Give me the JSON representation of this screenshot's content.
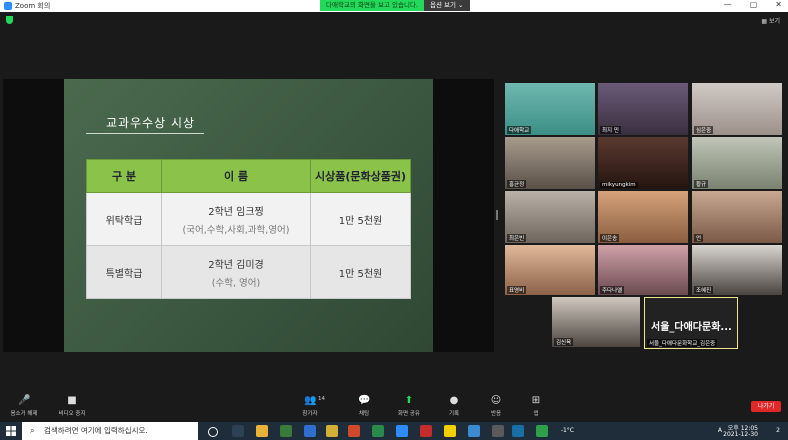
{
  "titlebar": {
    "app_title": "Zoom 회의",
    "min": "—",
    "max": "▢",
    "close": "✕"
  },
  "share_banner": {
    "message": "다애학교의 화면을 보고 있습니다.",
    "view_option": "옵션 보기 ⌄"
  },
  "view_button": "▦ 보기",
  "slide": {
    "title": "교과우수상 시상",
    "table": {
      "headers": [
        "구 분",
        "이 름",
        "시상품(문화상품권)"
      ],
      "rows": [
        {
          "category": "위탁학급",
          "name": "2학년 임크찡",
          "subjects": "(국어,수학,사회,과학,영어)",
          "prize": "1만 5천원"
        },
        {
          "category": "특별학급",
          "name": "2학년 김미경",
          "subjects": "(수학, 영어)",
          "prize": "1만 5천원"
        }
      ]
    }
  },
  "participants": [
    {
      "name": "다애학교"
    },
    {
      "name": "최지 민"
    },
    {
      "name": "심은중"
    },
    {
      "name": "홍균정"
    },
    {
      "name": "mikyungkim"
    },
    {
      "name": "황규"
    },
    {
      "name": "최은빈"
    },
    {
      "name": "이은송"
    },
    {
      "name": "언"
    },
    {
      "name": "표영비"
    },
    {
      "name": "주다나엘"
    },
    {
      "name": "조혜진"
    },
    {
      "name": "김신육"
    },
    {
      "name": "서울_다애다문화학교_김은중",
      "big_label": "서울_다애다문화..."
    }
  ],
  "toolbar": {
    "mute": "음소거 해제",
    "video": "비디오 중지",
    "participants": "참가자",
    "participants_count": "14",
    "chat": "채팅",
    "share": "화면 공유",
    "record": "기록",
    "reactions": "반응",
    "apps": "앱",
    "leave": "나가기"
  },
  "taskbar": {
    "search_placeholder": "검색하려면 여기에 입력하십시오.",
    "weather": "-1°C",
    "lang": "A",
    "time": "오후 12:05",
    "date": "2021-12-30",
    "notif": "2"
  },
  "colors": {
    "share_green": "#23d959",
    "leave_red": "#e02828",
    "table_header": "#8bc34a",
    "slide_bg": "#3e5a43"
  }
}
